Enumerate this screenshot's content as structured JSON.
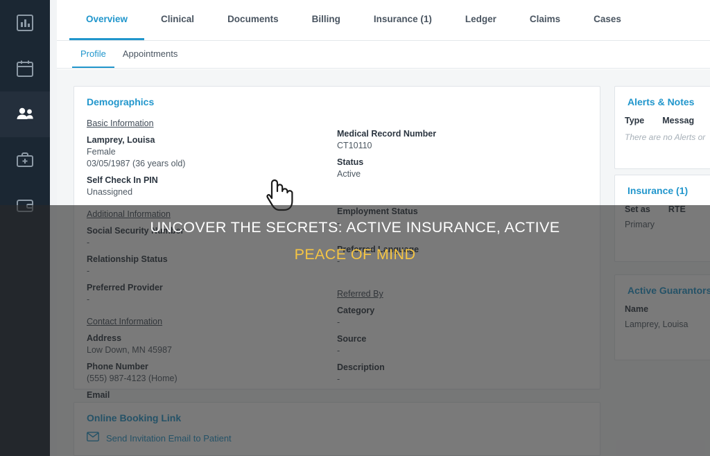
{
  "sidebar": {
    "items": [
      {
        "name": "reports-icon",
        "label": "Reports",
        "active": false
      },
      {
        "name": "calendar-icon",
        "label": "Calendar",
        "active": false
      },
      {
        "name": "patients-icon",
        "label": "Patients",
        "active": true
      },
      {
        "name": "medical-kit-icon",
        "label": "Clinical",
        "active": false
      },
      {
        "name": "billing-icon",
        "label": "Billing",
        "active": false
      }
    ]
  },
  "tabs": [
    {
      "label": "Overview",
      "active": true
    },
    {
      "label": "Clinical",
      "active": false
    },
    {
      "label": "Documents",
      "active": false
    },
    {
      "label": "Billing",
      "active": false
    },
    {
      "label": "Insurance (1)",
      "active": false
    },
    {
      "label": "Ledger",
      "active": false
    },
    {
      "label": "Claims",
      "active": false
    },
    {
      "label": "Cases",
      "active": false
    }
  ],
  "subtabs": [
    {
      "label": "Profile",
      "active": true
    },
    {
      "label": "Appointments",
      "active": false
    }
  ],
  "demographics": {
    "title": "Demographics",
    "left": {
      "basic_header": "Basic Information",
      "name": "Lamprey, Louisa",
      "gender": "Female",
      "dob": "03/05/1987 (36 years old)",
      "pin_label": "Self Check In PIN",
      "pin_value": "Unassigned",
      "additional_header": "Additional Information",
      "ssn_label": "Social Security Number",
      "ssn_value": "-",
      "relationship_label": "Relationship Status",
      "relationship_value": "-",
      "provider_label": "Preferred Provider",
      "provider_value": "-",
      "contact_header": "Contact Information",
      "address_label": "Address",
      "address_value": "Low Down, MN 45987",
      "phone_label": "Phone Number",
      "phone_value": "(555) 987-4123 (Home)",
      "email_label": "Email",
      "email_value": "-"
    },
    "right": {
      "mrn_label": "Medical Record Number",
      "mrn_value": "CT10110",
      "status_label": "Status",
      "status_value": "Active",
      "employment_label": "Employment Status",
      "employment_value": "-",
      "language_label": "Preferred Language",
      "language_value": "-",
      "referred_header": "Referred By",
      "category_label": "Category",
      "category_value": "-",
      "source_label": "Source",
      "source_value": "-",
      "description_label": "Description",
      "description_value": "-"
    }
  },
  "booking": {
    "title": "Online Booking Link",
    "invite_label": "Send Invitation Email to Patient"
  },
  "alerts": {
    "title": "Alerts & Notes",
    "col_type": "Type",
    "col_message": "Messag",
    "empty": "There are no Alerts or"
  },
  "insurance": {
    "title": "Insurance (1)",
    "col_setas": "Set as",
    "col_rte": "RTE",
    "row_primary": "Primary"
  },
  "guarantors": {
    "title": "Active Guarantors (",
    "col_name": "Name",
    "row_name": "Lamprey, Louisa"
  },
  "overlay": {
    "line1": "UNCOVER THE SECRETS: ACTIVE INSURANCE, ACTIVE",
    "line2": "PEACE OF MIND"
  },
  "colors": {
    "accent": "#2196cc",
    "sidebar": "#1b2733",
    "overlay_highlight": "#f5c544"
  }
}
